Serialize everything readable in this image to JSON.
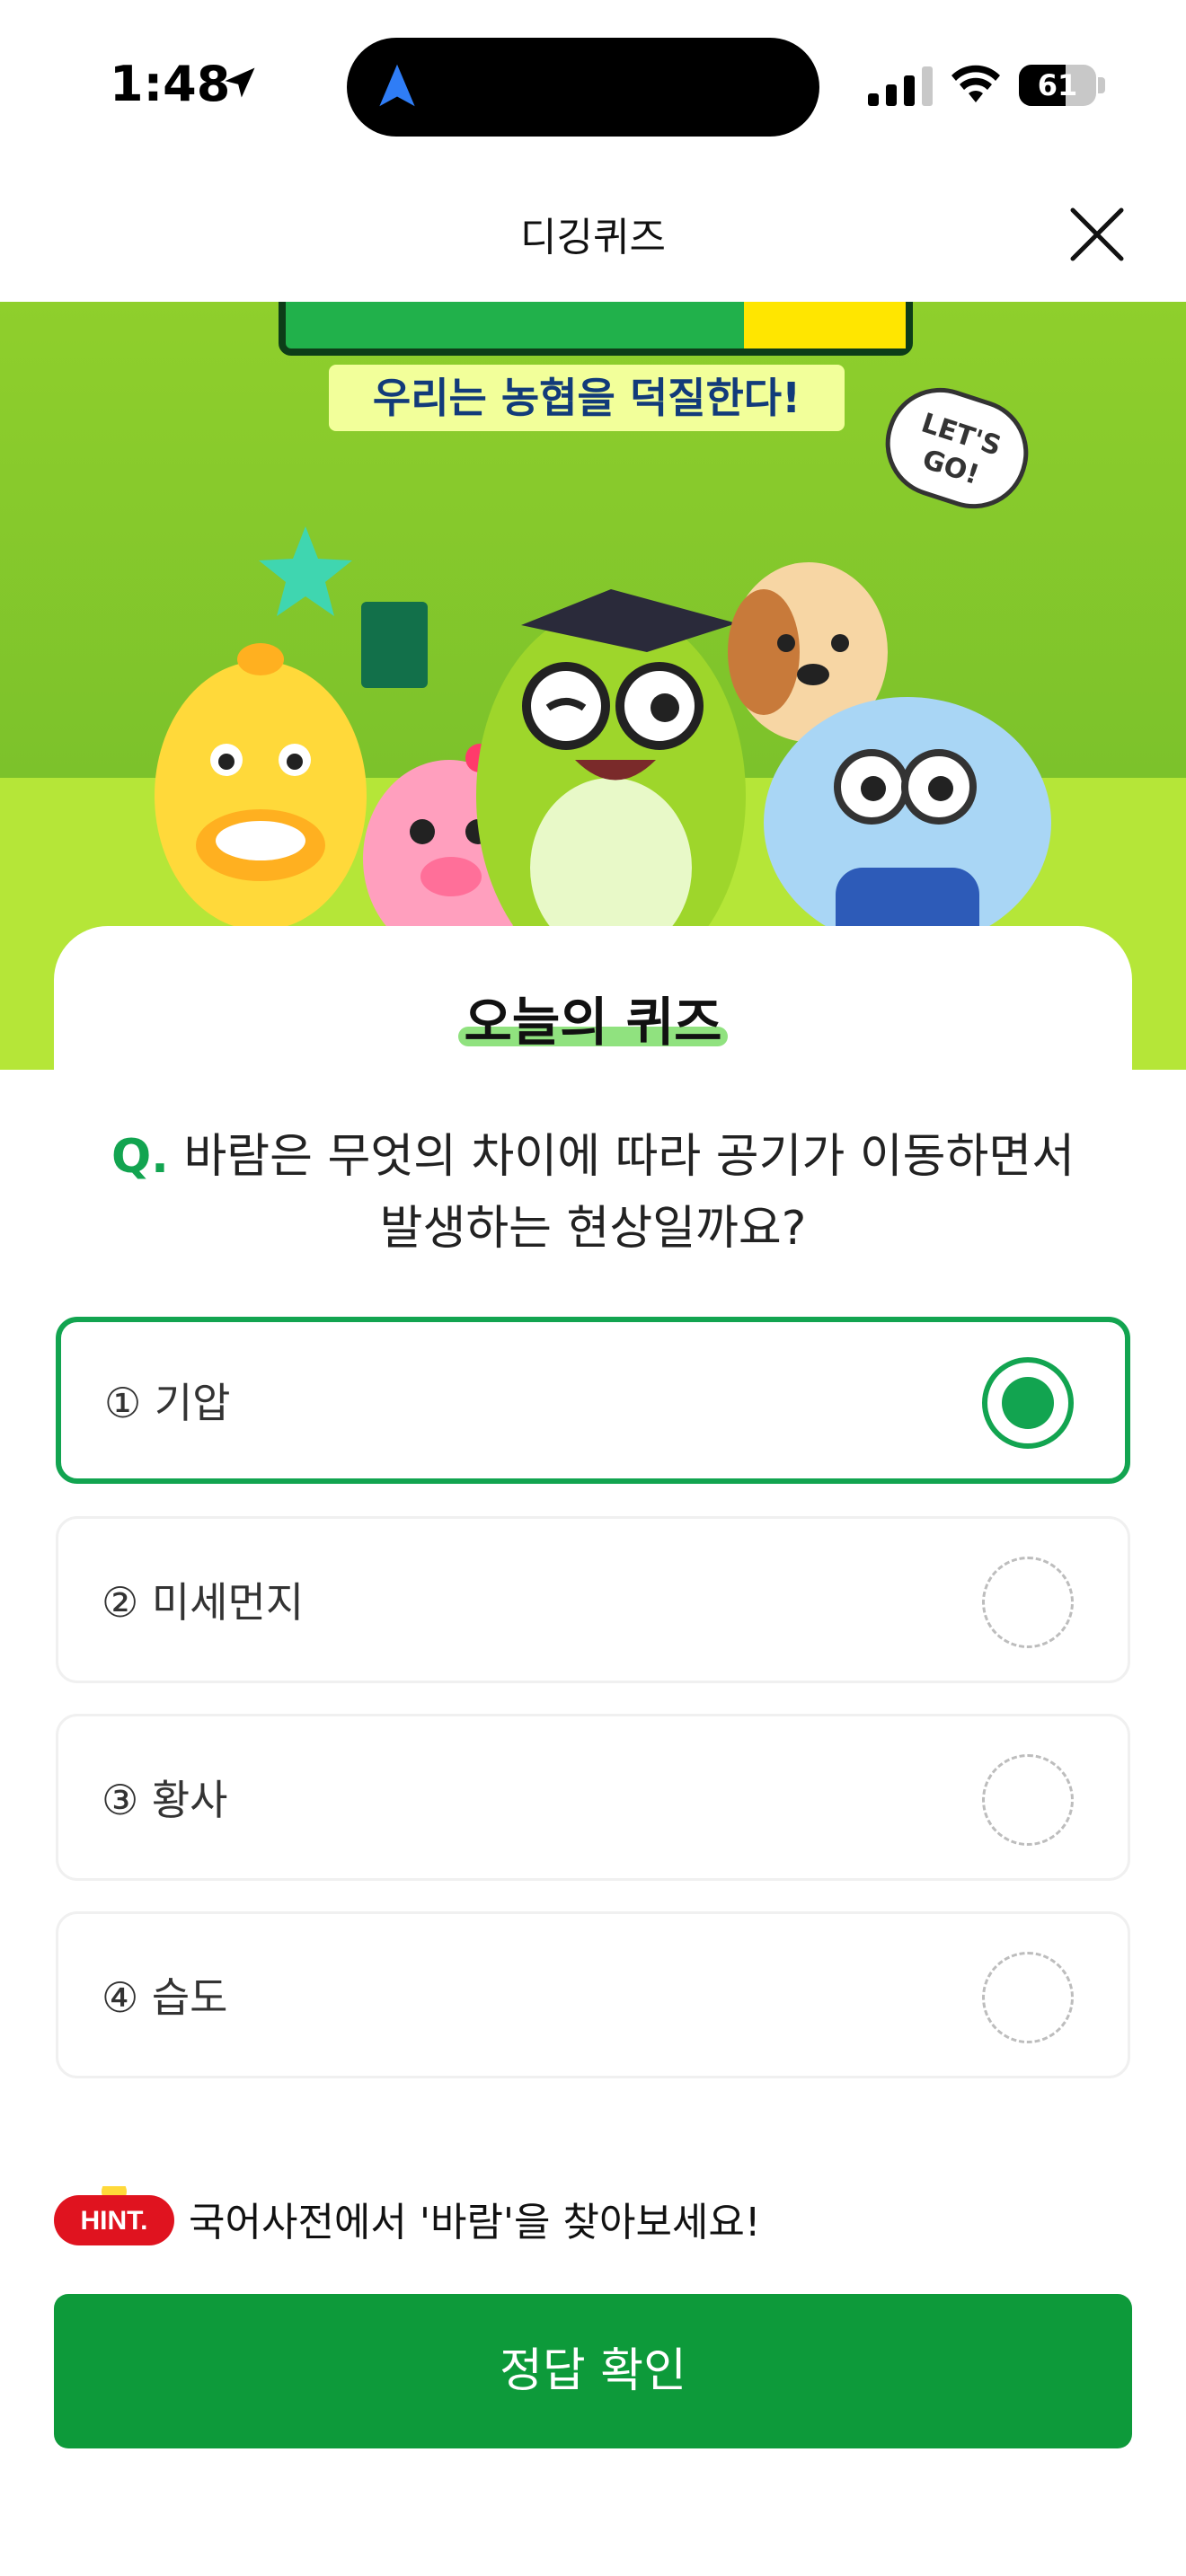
{
  "status_bar": {
    "time": "1:48",
    "battery_level": "61",
    "battery_fraction": 0.61,
    "icons": [
      "location-arrow-icon",
      "navigation-icon",
      "cellular-signal-icon",
      "wifi-icon",
      "battery-icon"
    ]
  },
  "nav": {
    "title": "디깅퀴즈",
    "close_icon": "close-icon"
  },
  "banner": {
    "subtitle": "우리는 농협을 덕질한다!",
    "bubble_text": "LET'S GO!"
  },
  "quiz": {
    "card_title": "오늘의 퀴즈",
    "question_prefix": "Q.",
    "question": "바람은 무엇의 차이에 따라 공기가 이동하면서 발생하는 현상일까요?",
    "options": [
      {
        "label": "① 기압",
        "selected": true
      },
      {
        "label": "② 미세먼지",
        "selected": false
      },
      {
        "label": "③ 황사",
        "selected": false
      },
      {
        "label": "④ 습도",
        "selected": false
      }
    ]
  },
  "hint": {
    "badge": "HINT.",
    "text": "국어사전에서 '바람'을 찾아보세요!"
  },
  "submit": {
    "label": "정답 확인"
  },
  "colors": {
    "accent": "#12a450",
    "button": "#0d9a3a",
    "banner_green": "#b5e638"
  }
}
